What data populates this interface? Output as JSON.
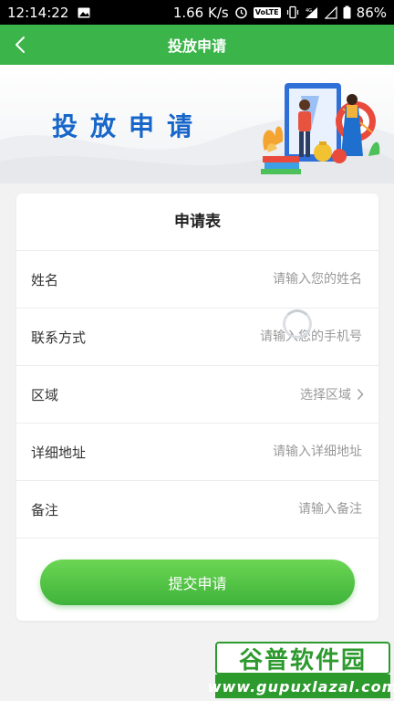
{
  "status_bar": {
    "time": "12:14:22",
    "network_speed": "1.66 K/s",
    "volte": "VoLTE",
    "signal": "4G",
    "battery": "86%"
  },
  "app_bar": {
    "title": "投放申请",
    "back_icon": "chevron-left-icon",
    "color": "#3bb54a"
  },
  "banner": {
    "title": "投放申请"
  },
  "form": {
    "title": "申请表",
    "fields": [
      {
        "label": "姓名",
        "placeholder": "请输入您的姓名"
      },
      {
        "label": "联系方式",
        "placeholder": "请输入您的手机号"
      },
      {
        "label": "区域",
        "placeholder": "选择区域"
      },
      {
        "label": "详细地址",
        "placeholder": "请输入详细地址"
      },
      {
        "label": "备注",
        "placeholder": "请输入备注"
      }
    ],
    "submit_label": "提交申请"
  },
  "watermark": {
    "brand": "谷普软件园",
    "url": "www.gupuxlazal.com"
  }
}
